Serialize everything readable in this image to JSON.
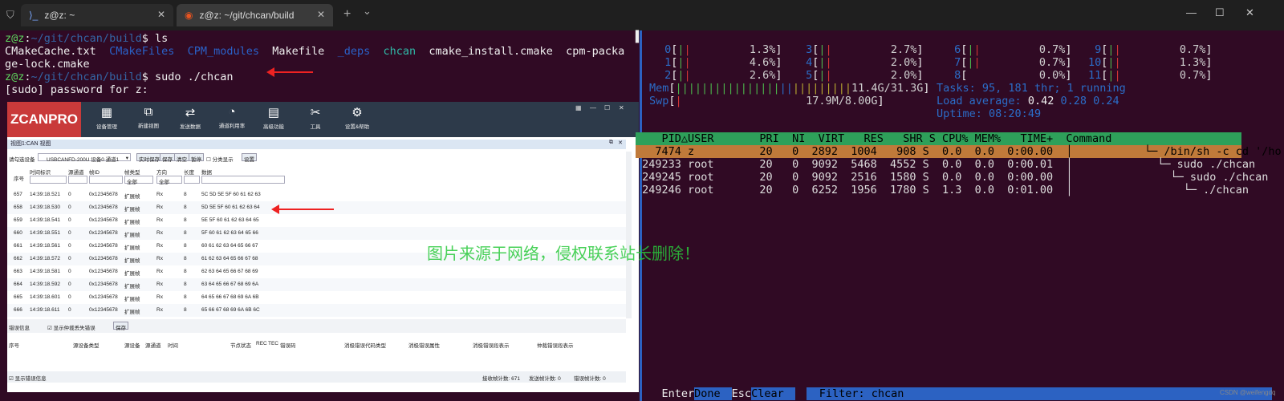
{
  "tabbar": {
    "tab1_title": "z@z: ~",
    "tab2_title": "z@z: ~/git/chcan/build",
    "new_tab": "+",
    "dropdown": "⌄"
  },
  "left_terminal": {
    "prompt_user": "z@z",
    "prompt_path": "~/git/chcan/build",
    "cmd1": "$ ls",
    "ls_items": [
      "CMakeCache.txt",
      "CMakeFiles",
      "CPM_modules",
      "Makefile",
      "_deps",
      "chcan",
      "cmake_install.cmake",
      "cpm-packa"
    ],
    "ls_wrap": "ge-lock.cmake",
    "cmd2": "$ sudo ./chcan",
    "sudo_prompt": "[sudo] password for z:"
  },
  "zcanpro": {
    "logo": "ZCANPRO",
    "toolbar": [
      "设备管理",
      "新建视图",
      "发送数据",
      "通道利用率",
      "高级功能",
      "工具",
      "设置&帮助"
    ],
    "view_title": "视图1:CAN 视图",
    "device_label": "请勾选设备",
    "device_select": "USBCANFD-200U 设备0 通道1",
    "buttons": [
      "实时保存",
      "保存",
      "清空",
      "暂停"
    ],
    "category_label": "分类显示",
    "settings_btn": "设置",
    "columns": [
      "序号",
      "时间标识",
      "源通道",
      "帧ID",
      "帧类型",
      "方向",
      "长度",
      "数据"
    ],
    "filter_all": "全部",
    "rows": [
      [
        "657",
        "14:39:18.521",
        "0",
        "0x12345678",
        "扩展帧",
        "Rx",
        "8",
        "5C 5D 5E 5F 60 61 62 63"
      ],
      [
        "658",
        "14:39:18.530",
        "0",
        "0x12345678",
        "扩展帧",
        "Rx",
        "8",
        "5D 5E 5F 60 61 62 63 64"
      ],
      [
        "659",
        "14:39:18.541",
        "0",
        "0x12345678",
        "扩展帧",
        "Rx",
        "8",
        "5E 5F 60 61 62 63 64 65"
      ],
      [
        "660",
        "14:39:18.551",
        "0",
        "0x12345678",
        "扩展帧",
        "Rx",
        "8",
        "5F 60 61 62 63 64 65 66"
      ],
      [
        "661",
        "14:39:18.561",
        "0",
        "0x12345678",
        "扩展帧",
        "Rx",
        "8",
        "60 61 62 63 64 65 66 67"
      ],
      [
        "662",
        "14:39:18.572",
        "0",
        "0x12345678",
        "扩展帧",
        "Rx",
        "8",
        "61 62 63 64 65 66 67 68"
      ],
      [
        "663",
        "14:39:18.581",
        "0",
        "0x12345678",
        "扩展帧",
        "Rx",
        "8",
        "62 63 64 65 66 67 68 69"
      ],
      [
        "664",
        "14:39:18.592",
        "0",
        "0x12345678",
        "扩展帧",
        "Rx",
        "8",
        "63 64 65 66 67 68 69 6A"
      ],
      [
        "665",
        "14:39:18.601",
        "0",
        "0x12345678",
        "扩展帧",
        "Rx",
        "8",
        "64 65 66 67 68 69 6A 6B"
      ],
      [
        "666",
        "14:39:18.611",
        "0",
        "0x12345678",
        "扩展帧",
        "Rx",
        "8",
        "65 66 67 68 69 6A 6B 6C"
      ]
    ],
    "error_label": "错误信息",
    "show_lost_label": "显示仲裁丢失错误",
    "save_btn": "保存",
    "error_columns": [
      "序号",
      "源设备类型",
      "源设备",
      "源通道",
      "时间",
      "节点状态",
      "REC",
      "TEC",
      "错误码",
      "消极错误代码类型",
      "消极错误属性",
      "消极错误段表示",
      "仲裁错误段表示"
    ],
    "show_errors": "显示错误信息",
    "recv_count": "接收帧计数: 671",
    "send_count": "发送帧计数: 0",
    "err_count": "错误帧计数: 0"
  },
  "htop": {
    "cpus": [
      {
        "id": "0",
        "pct": "1.3%"
      },
      {
        "id": "1",
        "pct": "4.6%"
      },
      {
        "id": "2",
        "pct": "2.6%"
      },
      {
        "id": "3",
        "pct": "2.7%"
      },
      {
        "id": "4",
        "pct": "2.0%"
      },
      {
        "id": "5",
        "pct": "2.0%"
      },
      {
        "id": "6",
        "pct": "0.7%"
      },
      {
        "id": "7",
        "pct": "0.7%"
      },
      {
        "id": "8",
        "pct": "0.0%"
      },
      {
        "id": "9",
        "pct": "0.7%"
      },
      {
        "id": "10",
        "pct": "1.3%"
      },
      {
        "id": "11",
        "pct": "0.7%"
      }
    ],
    "mem_label": "Mem",
    "mem_value": "11.4G/31.3G",
    "swp_label": "Swp",
    "swp_value": "17.9M/8.00G",
    "tasks_label": "Tasks:",
    "tasks_value": "95, 181 thr; 1 running",
    "load_label": "Load average:",
    "load_1": "0.42",
    "load_rest": "0.28 0.24",
    "uptime_label": "Uptime:",
    "uptime_value": "08:20:49",
    "header": "    PID△USER       PRI  NI  VIRT   RES   SHR S CPU% MEM%   TIME+  Command",
    "processes": [
      {
        "pid": "7474",
        "user": "z",
        "pri": "20",
        "ni": "0",
        "virt": "2892",
        "res": "1004",
        "shr": "908",
        "s": "S",
        "cpu": "0.0",
        "mem": "0.0",
        "time": "0:00.00",
        "cmd": "└─ /bin/sh -c cd '/ho"
      },
      {
        "pid": "249233",
        "user": "root",
        "pri": "20",
        "ni": "0",
        "virt": "9092",
        "res": "5468",
        "shr": "4552",
        "s": "S",
        "cpu": "0.0",
        "mem": "0.0",
        "time": "0:00.01",
        "cmd": "└─ sudo ./chcan"
      },
      {
        "pid": "249245",
        "user": "root",
        "pri": "20",
        "ni": "0",
        "virt": "9092",
        "res": "2516",
        "shr": "1580",
        "s": "S",
        "cpu": "0.0",
        "mem": "0.0",
        "time": "0:00.00",
        "cmd": "└─ sudo ./chcan"
      },
      {
        "pid": "249246",
        "user": "root",
        "pri": "20",
        "ni": "0",
        "virt": "6252",
        "res": "1956",
        "shr": "1780",
        "s": "S",
        "cpu": "1.3",
        "mem": "0.0",
        "time": "0:01.00",
        "cmd": "└─ ./chcan"
      }
    ],
    "footer_enter": "Enter",
    "footer_done": "Done",
    "footer_esc": "Esc",
    "footer_clear": "Clear",
    "footer_filter": "Filter: chcan"
  },
  "watermark": "图片来源于网络，侵权联系站长删除！",
  "csdn": "CSDN @weifengdq",
  "colors": {
    "terminal_bg": "#300a24",
    "accent_blue": "#2c62c2",
    "htop_header": "#2ea05a",
    "htop_selected": "#c07a3a"
  }
}
